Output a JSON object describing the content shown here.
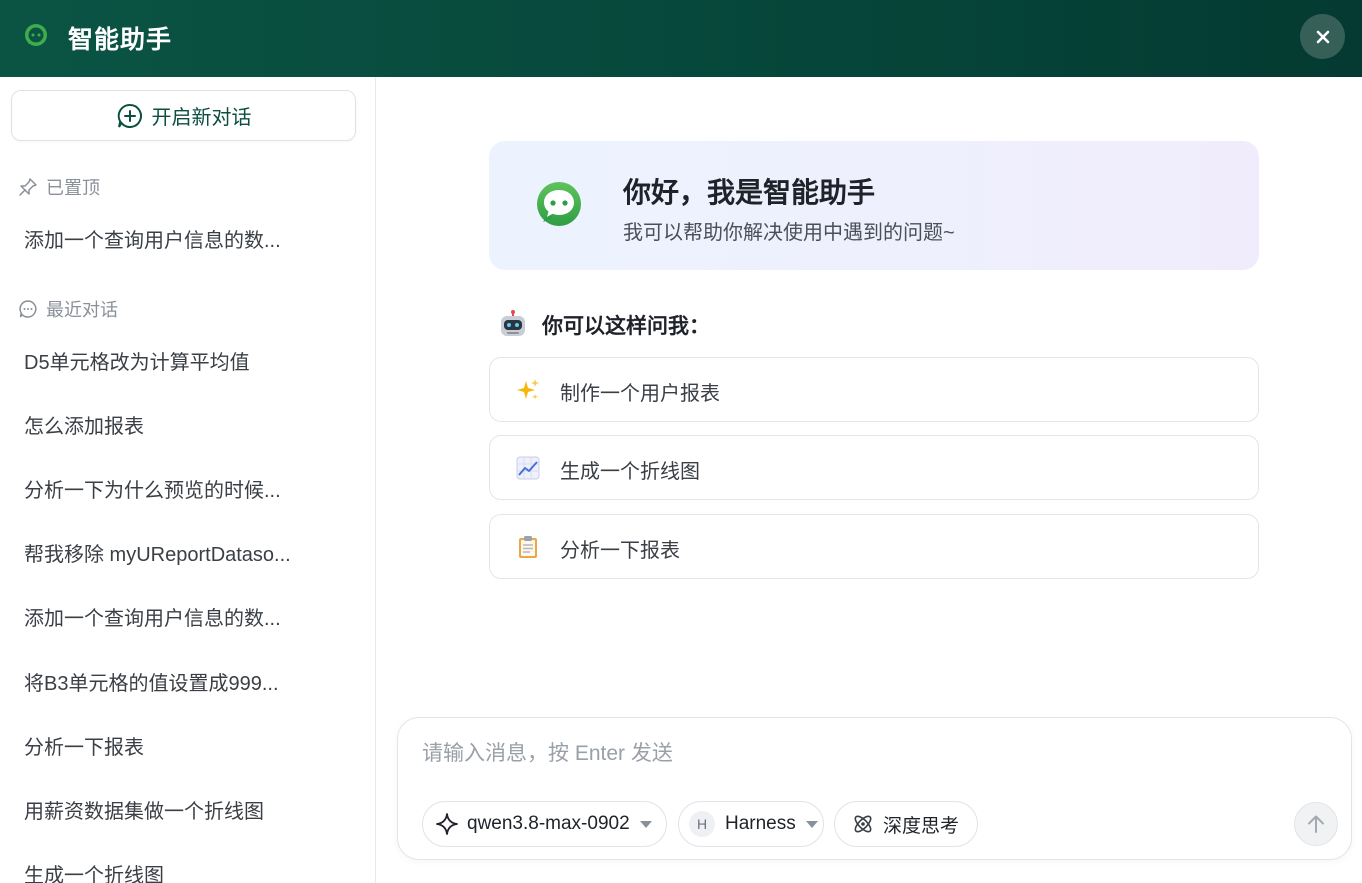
{
  "app": {
    "title": "智能助手"
  },
  "sidebar": {
    "new_chat_label": "开启新对话",
    "pinned_heading": "已置顶",
    "pinned": [
      "添加一个查询用户信息的数..."
    ],
    "recent_heading": "最近对话",
    "recent": [
      "D5单元格改为计算平均值",
      "怎么添加报表",
      "分析一下为什么预览的时候...",
      "帮我移除 myUReportDataso...",
      "添加一个查询用户信息的数...",
      "将B3单元格的值设置成999...",
      "分析一下报表",
      "用薪资数据集做一个折线图",
      "生成一个折线图"
    ]
  },
  "welcome": {
    "greeting": "你好，我是智能助手",
    "subtitle": "我可以帮助你解决使用中遇到的问题~"
  },
  "suggestions": {
    "heading": "你可以这样问我：",
    "items": [
      {
        "icon": "sparkles-icon",
        "label": "制作一个用户报表"
      },
      {
        "icon": "line-chart-icon",
        "label": "生成一个折线图"
      },
      {
        "icon": "clipboard-icon",
        "label": "分析一下报表"
      }
    ]
  },
  "composer": {
    "placeholder": "请输入消息，按 Enter 发送",
    "model": "qwen3.8-max-0902",
    "agent_badge": "H",
    "agent": "Harness",
    "deep_think": "深度思考"
  },
  "colors": {
    "header_bg": "#06463a",
    "accent": "#0b4f41",
    "brand_green": "#3dae4a"
  }
}
